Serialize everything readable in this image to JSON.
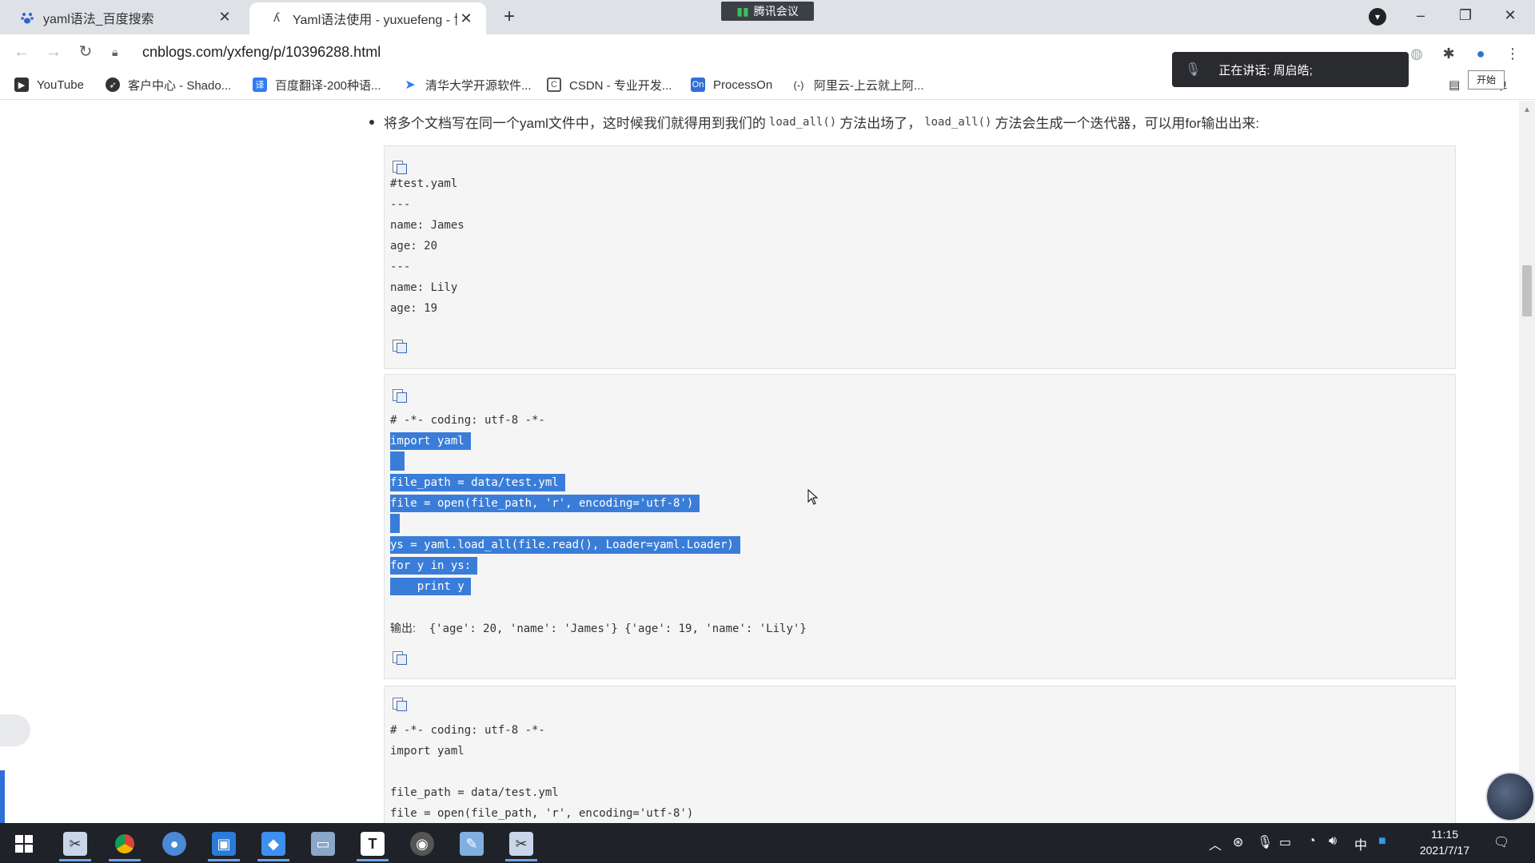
{
  "browser": {
    "tabs": [
      {
        "title": "yaml语法_百度搜索",
        "active": false,
        "icon": "baidu-paw-icon"
      },
      {
        "title": "Yaml语法使用 - yuxuefeng - 博",
        "active": true,
        "icon": "cnblogs-icon"
      }
    ],
    "new_tab_symbol": "+",
    "meeting_badge": "腾讯会议",
    "url": "cnblogs.com/yxfeng/p/10396288.html",
    "bookmarks": [
      {
        "label": "YouTube",
        "icon_color": "#333333"
      },
      {
        "label": "客户中心 - Shado...",
        "icon_color": "#333333"
      },
      {
        "label": "百度翻译-200种语...",
        "icon_color": "#2f7cf6"
      },
      {
        "label": "清华大学开源软件...",
        "icon_color": "#2f7cf6"
      },
      {
        "label": "CSDN - 专业开发...",
        "icon_color": "#555555"
      },
      {
        "label": "ProcessOn",
        "icon_color": "#2f6fd6"
      },
      {
        "label": "阿里云-上云就上阿...",
        "icon_color": "#333333"
      }
    ],
    "reading_list_label": "单"
  },
  "overlay": {
    "speaking_text": "正在讲话: 周启皓;",
    "start_label": "开始"
  },
  "article": {
    "intro": {
      "before": "将多个文档写在同一个yaml文件中，这时候我们就得用到我们的",
      "code1": "load_all()",
      "middle": "方法出场了，",
      "code2": "load_all()",
      "after": "方法会生成一个迭代器，可以用for输出出来:"
    },
    "block1": {
      "lines": [
        "#test.yaml",
        "---",
        "name: James",
        "age: 20",
        "---",
        "name: Lily",
        "age: 19"
      ]
    },
    "block2": {
      "header": "# -*- coding: utf-8 -*-",
      "selected": [
        "import yaml",
        "",
        "file_path = data/test.yml",
        "file = open(file_path, 'r', encoding='utf-8')",
        "",
        "ys = yaml.load_all(file.read(), Loader=yaml.Loader)",
        "for y in ys:",
        "    print y"
      ],
      "output_label": "输出:",
      "output_value": "{'age': 20, 'name': 'James'} {'age': 19, 'name': 'Lily'}"
    },
    "block3": {
      "lines": [
        "# -*- coding: utf-8 -*-",
        "import yaml",
        "",
        "file_path = data/test.yml",
        "file = open(file_path, 'r', encoding='utf-8')"
      ]
    }
  },
  "taskbar": {
    "apps": [
      "snip-tool",
      "chrome",
      "wechat",
      "remote-desktop",
      "tencent-meeting",
      "explorer",
      "typora",
      "obs",
      "notepad",
      "snip-tool-2"
    ],
    "typora_letter": "T",
    "tray_ime": "中",
    "time": "11:15",
    "date": "2021/7/17"
  },
  "colors": {
    "selection": "#3a7dd8",
    "taskbar": "#1f2228",
    "tabstrip": "#dee1e6"
  }
}
